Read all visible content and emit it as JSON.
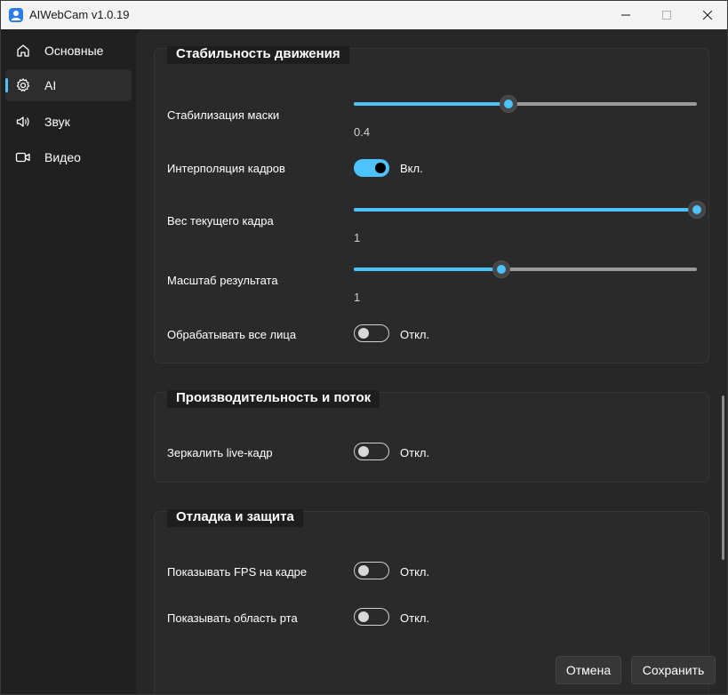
{
  "window": {
    "title": "AIWebCam v1.0.19",
    "controls": {
      "minimize": "—",
      "maximize": "☐",
      "close": "✕"
    }
  },
  "sidebar": {
    "items": [
      {
        "label": "Основные",
        "icon": "home-icon",
        "active": false
      },
      {
        "label": "AI",
        "icon": "gear-icon",
        "active": true
      },
      {
        "label": "Звук",
        "icon": "speaker-icon",
        "active": false
      },
      {
        "label": "Видео",
        "icon": "video-camera-icon",
        "active": false
      }
    ]
  },
  "sections": {
    "motion": {
      "title": "Стабильность движения",
      "mask_stabilization": {
        "label": "Стабилизация маски",
        "value": "0.4",
        "fraction": 0.45
      },
      "frame_interpolation": {
        "label": "Интерполяция кадров",
        "state": "Вкл.",
        "on": true
      },
      "current_frame_weight": {
        "label": "Вес текущего кадра",
        "value": "1",
        "fraction": 1.0
      },
      "result_scale": {
        "label": "Масштаб результата",
        "value": "1",
        "fraction": 0.43
      },
      "process_all_faces": {
        "label": "Обрабатывать все лица",
        "state": "Откл.",
        "on": false
      }
    },
    "performance": {
      "title": "Производительность и поток",
      "mirror_live": {
        "label": "Зеркалить live-кадр",
        "state": "Откл.",
        "on": false
      }
    },
    "debug": {
      "title": "Отладка и защита",
      "show_fps": {
        "label": "Показывать FPS на кадре",
        "state": "Откл.",
        "on": false
      },
      "show_mouth": {
        "label": "Показывать область рта",
        "state": "Откл.",
        "on": false
      }
    }
  },
  "footer": {
    "cancel_label": "Отмена",
    "save_label": "Сохранить"
  },
  "colors": {
    "accent": "#4cc2ff",
    "background": "#202020",
    "content": "#272727"
  }
}
